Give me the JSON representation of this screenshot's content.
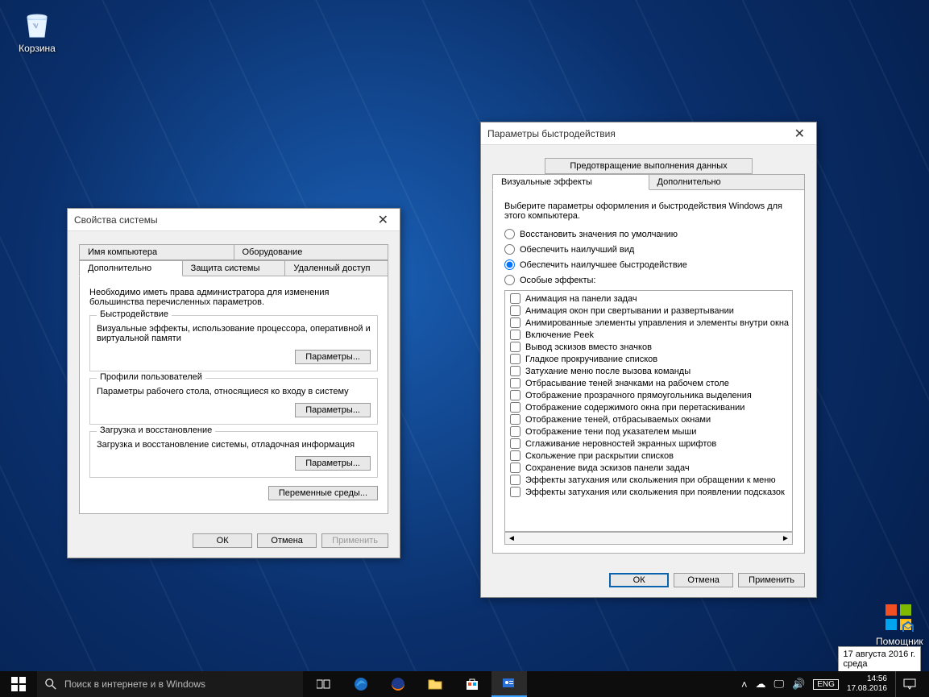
{
  "desktop": {
    "recycle_label": "Корзина",
    "helper_label": "Помощник"
  },
  "sysprops": {
    "title": "Свойства системы",
    "tabs_row1": [
      "Имя компьютера",
      "Оборудование"
    ],
    "tabs_row2": [
      "Дополнительно",
      "Защита системы",
      "Удаленный доступ"
    ],
    "active_tab": "Дополнительно",
    "note": "Необходимо иметь права администратора для изменения большинства перечисленных параметров.",
    "groups": {
      "perf": {
        "title": "Быстродействие",
        "desc": "Визуальные эффекты, использование процессора, оперативной и виртуальной памяти",
        "btn": "Параметры..."
      },
      "profiles": {
        "title": "Профили пользователей",
        "desc": "Параметры рабочего стола, относящиеся ко входу в систему",
        "btn": "Параметры..."
      },
      "startup": {
        "title": "Загрузка и восстановление",
        "desc": "Загрузка и восстановление системы, отладочная информация",
        "btn": "Параметры..."
      }
    },
    "env_btn": "Переменные среды...",
    "footer": {
      "ok": "ОК",
      "cancel": "Отмена",
      "apply": "Применить"
    }
  },
  "perf": {
    "title": "Параметры быстродействия",
    "tabs_row1": [
      "Предотвращение выполнения данных"
    ],
    "tabs_row2": [
      "Визуальные эффекты",
      "Дополнительно"
    ],
    "active_tab": "Визуальные эффекты",
    "intro": "Выберите параметры оформления и быстродействия Windows для этого компьютера.",
    "radios": {
      "restore": "Восстановить значения по умолчанию",
      "bestlook": "Обеспечить наилучший вид",
      "bestperf": "Обеспечить наилучшее быстродействие",
      "custom": "Особые эффекты:"
    },
    "selected_radio": "bestperf",
    "effects": [
      "Анимация на панели задач",
      "Анимация окон при свертывании и развертывании",
      "Анимированные элементы управления и элементы внутри окна",
      "Включение Peek",
      "Вывод эскизов вместо значков",
      "Гладкое прокручивание списков",
      "Затухание меню после вызова команды",
      "Отбрасывание теней значками на рабочем столе",
      "Отображение прозрачного прямоугольника выделения",
      "Отображение содержимого окна при перетаскивании",
      "Отображение теней, отбрасываемых окнами",
      "Отображение тени под указателем мыши",
      "Сглаживание неровностей экранных шрифтов",
      "Скольжение при раскрытии списков",
      "Сохранение вида эскизов панели задач",
      "Эффекты затухания или скольжения при обращении к меню",
      "Эффекты затухания или скольжения при появлении подсказок"
    ],
    "footer": {
      "ok": "ОК",
      "cancel": "Отмена",
      "apply": "Применить"
    }
  },
  "tooltip": {
    "line1": "17 августа 2016 г.",
    "line2": "среда"
  },
  "taskbar": {
    "search_placeholder": "Поиск в интернете и в Windows",
    "lang": "ENG",
    "time": "14:56",
    "date": "17.08.2016"
  }
}
